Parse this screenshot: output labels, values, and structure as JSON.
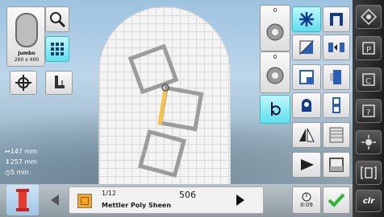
{
  "hoop": {
    "name": "Jumbo",
    "size": "260 x 400"
  },
  "stats": {
    "width": "147 mm",
    "height": "257 mm",
    "time": "5 min."
  },
  "info": {
    "color_index": "1/12",
    "thread_name": "Mettler Poly Sheen",
    "thread_number": "506"
  },
  "counters": {
    "top": "0",
    "middle": "0"
  },
  "time_button": {
    "label": "0:09"
  },
  "right_bar": {
    "clr_label": "clr"
  },
  "colors": {
    "accent_cyan": "#5fe0ec",
    "selected_thread": "#e83a2a",
    "color_swatch": "#f5a623",
    "confirm_green": "#2fb52f"
  }
}
